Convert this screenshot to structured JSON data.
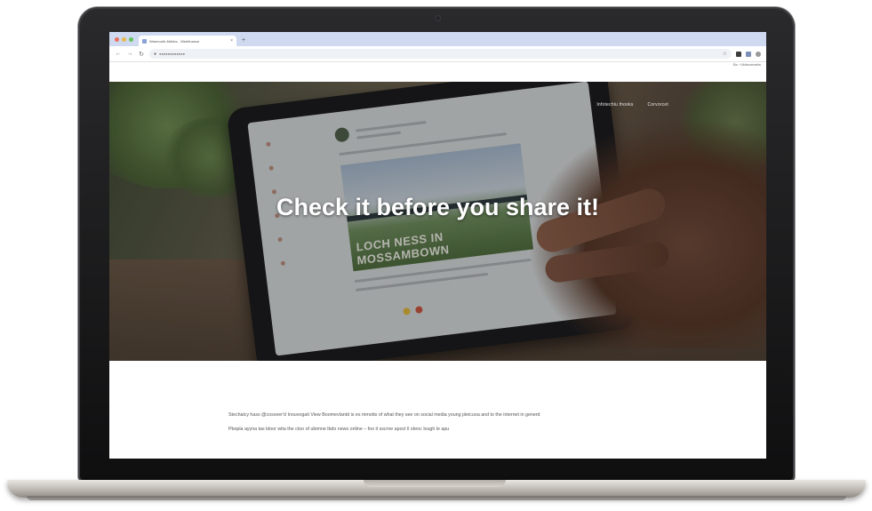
{
  "browser": {
    "tab_title": "Warmouth-Mebbs - Webfinance",
    "new_tab_glyph": "+",
    "url": "●●●●●●●●●●●●",
    "bookmarks_label": "Bo ~Ublaurmarks",
    "window_dot_colors": [
      "#e8715f",
      "#e9b94b",
      "#63c35b"
    ]
  },
  "icons": {
    "back": "←",
    "forward": "→",
    "reload": "↻",
    "lock": "●",
    "star": "☆",
    "close": "×"
  },
  "hero": {
    "nav_items": [
      "Infotechlu thooks",
      "Corvorcet"
    ],
    "title": "Check it before you share it!",
    "tablet_caption": "LOCH NESS IN MOSSAMBOWN"
  },
  "content": {
    "paragraphs": [
      "Stechalcy hass @cosover'd Inouvogati View Boomevlantd is es mmotts of what they see on social media young pleicuoa and to the internet in generd",
      "Pbopla ayyna tas ldoor wita the ctoo of ubimne lbdo news online – foo it sscrne apoct ll sbroc lough le apu"
    ]
  }
}
